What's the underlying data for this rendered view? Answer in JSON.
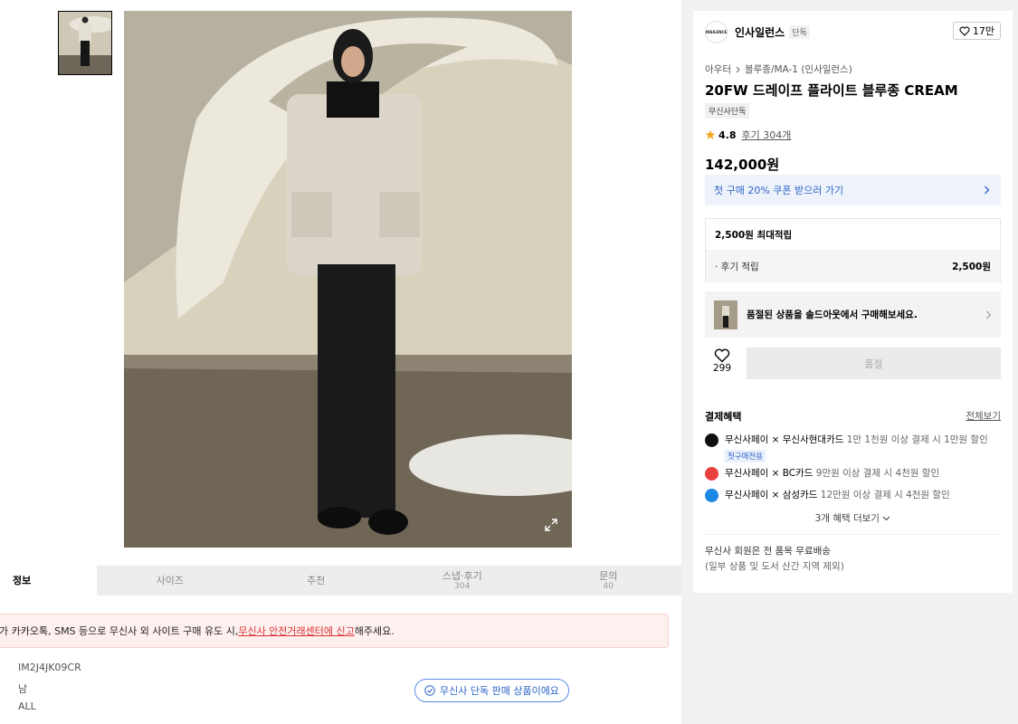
{
  "gallery": {
    "thumbnail_alt": "product thumbnail",
    "expand_icon": "expand-icon"
  },
  "tabs": [
    {
      "label": "정보",
      "count": ""
    },
    {
      "label": "사이즈",
      "count": ""
    },
    {
      "label": "추천",
      "count": ""
    },
    {
      "label": "스냅·후기",
      "count": "304"
    },
    {
      "label": "문의",
      "count": "40"
    }
  ],
  "warning": {
    "prefix": "가 카카오톡, SMS 등으로 무신사 외 사이트 구매 유도 시, ",
    "link": "무신사 안전거래센터에 신고",
    "suffix": " 해주세요."
  },
  "product_info": {
    "code": "IM2J4JK09CR",
    "gender": "남",
    "season": "ALL",
    "exclusive_pill": "무신사 단독 판매 상품이에요"
  },
  "brand": {
    "logo_text": "INSILENCE",
    "name": "인사일런스",
    "badge": "단독",
    "likes": "17만"
  },
  "breadcrumb": [
    "아우터",
    "블루종/MA-1 (인사일런스)"
  ],
  "product": {
    "title": "20FW 드레이프 플라이트 블루종 CREAM",
    "exclusive_badge": "무신사단독",
    "rating": "4.8",
    "reviews": "후기 304개",
    "price": "142,000원"
  },
  "coupon": {
    "label": "첫 구매 20% 쿠폰 받으러 가기"
  },
  "points": {
    "header": "2,500원 최대적립",
    "row_label": "· 후기 적립",
    "row_amount": "2,500원"
  },
  "soldout_banner": {
    "label": "품절된 상품을 솔드아웃에서 구매해보세요."
  },
  "wishlist": {
    "count": "299"
  },
  "buy_button": {
    "label": "품절"
  },
  "benefits": {
    "header": "결제혜택",
    "view_all": "전체보기",
    "items": [
      {
        "title": "무신사페이 × 무신사현대카드",
        "desc": "1만 1천원 이상 결제 시 1만원 할인",
        "tag": "첫구매전용",
        "color": "#111111"
      },
      {
        "title": "무신사페이 × BC카드",
        "desc": "9만원 이상 결제 시 4천원 할인",
        "tag": "",
        "color": "#e8413e"
      },
      {
        "title": "무신사페이 × 삼성카드",
        "desc": "12만원 이상 결제 시 4천원 할인",
        "tag": "",
        "color": "#1e88e5"
      }
    ],
    "more": "3개 혜택 더보기"
  },
  "shipping": {
    "line1": "무신사 회원은 전 품목 무료배송",
    "line2": "(일부 상품 및 도서 산간 지역 제외)"
  }
}
